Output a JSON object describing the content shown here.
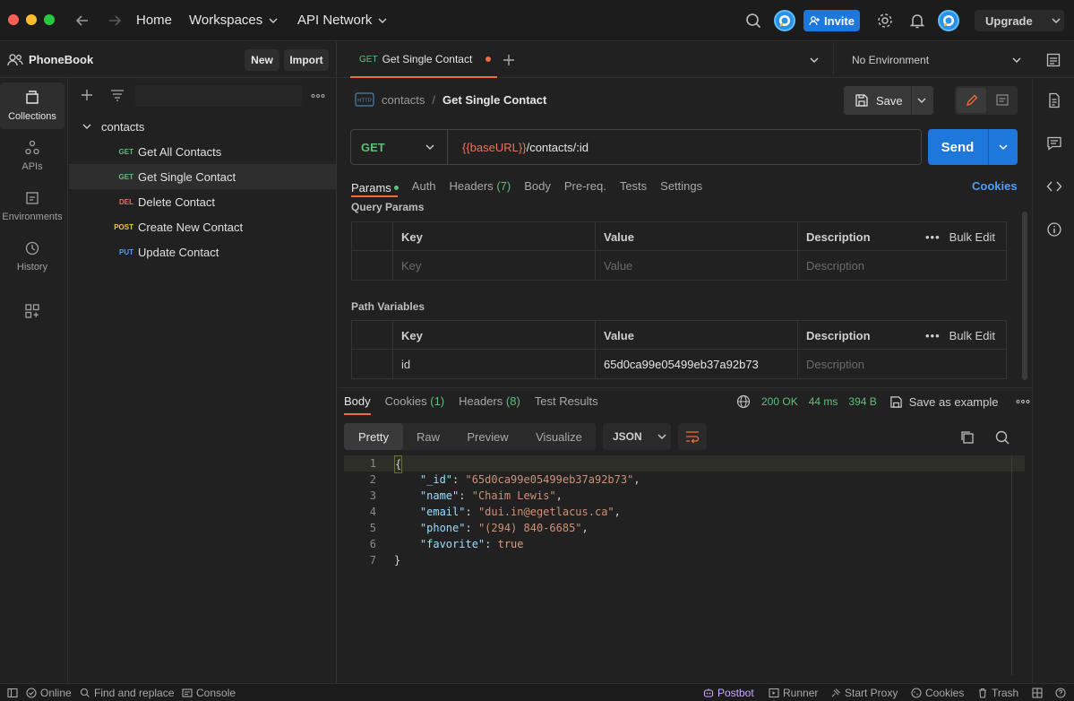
{
  "titlebar": {
    "nav": {
      "home": "Home",
      "workspaces": "Workspaces",
      "api_network": "API Network"
    },
    "invite": "Invite",
    "upgrade": "Upgrade"
  },
  "sidebar": {
    "workspace": "PhoneBook",
    "new": "New",
    "import": "Import",
    "rail": [
      {
        "label": "Collections",
        "icon": "collections-icon"
      },
      {
        "label": "APIs",
        "icon": "apis-icon"
      },
      {
        "label": "Environments",
        "icon": "environments-icon"
      },
      {
        "label": "History",
        "icon": "history-icon"
      }
    ],
    "collection": "contacts",
    "requests": [
      {
        "method": "GET",
        "name": "Get All Contacts"
      },
      {
        "method": "GET",
        "name": "Get Single Contact"
      },
      {
        "method": "DEL",
        "name": "Delete Contact"
      },
      {
        "method": "POST",
        "name": "Create New Contact"
      },
      {
        "method": "PUT",
        "name": "Update Contact"
      }
    ]
  },
  "tabs": {
    "active_method": "GET",
    "active_name": "Get Single Contact",
    "environment": "No Environment"
  },
  "request": {
    "breadcrumb_parent": "contacts",
    "breadcrumb_sep": "/",
    "breadcrumb_current": "Get Single Contact",
    "save": "Save",
    "method": "GET",
    "url_var": "{{baseURL}}",
    "url_path": "/contacts/:id",
    "send": "Send",
    "tabs": {
      "params": "Params",
      "auth": "Auth",
      "headers": "Headers",
      "headers_count": "(7)",
      "body": "Body",
      "prereq": "Pre-req.",
      "tests": "Tests",
      "settings": "Settings"
    },
    "cookies": "Cookies",
    "query_params": {
      "title": "Query Params",
      "headers": {
        "key": "Key",
        "value": "Value",
        "description": "Description",
        "bulk_edit": "Bulk Edit"
      },
      "placeholder": {
        "key": "Key",
        "value": "Value",
        "description": "Description"
      }
    },
    "path_variables": {
      "title": "Path Variables",
      "headers": {
        "key": "Key",
        "value": "Value",
        "description": "Description",
        "bulk_edit": "Bulk Edit"
      },
      "row": {
        "key": "id",
        "value": "65d0ca99e05499eb37a92b73",
        "description": "Description"
      }
    }
  },
  "response": {
    "tabs": {
      "body": "Body",
      "cookies": "Cookies",
      "cookies_count": "(1)",
      "headers": "Headers",
      "headers_count": "(8)",
      "test_results": "Test Results"
    },
    "status": "200 OK",
    "time": "44 ms",
    "size": "394 B",
    "save_example": "Save as example",
    "views": {
      "pretty": "Pretty",
      "raw": "Raw",
      "preview": "Preview",
      "visualize": "Visualize"
    },
    "format": "JSON",
    "lines": [
      {
        "n": "1",
        "text": "{"
      },
      {
        "n": "2",
        "key": "\"_id\"",
        "val": "\"65d0ca99e05499eb37a92b73\"",
        "trail": ","
      },
      {
        "n": "3",
        "key": "\"name\"",
        "val": "\"Chaim Lewis\"",
        "trail": ","
      },
      {
        "n": "4",
        "key": "\"email\"",
        "val": "\"dui.in@egetlacus.ca\"",
        "trail": ","
      },
      {
        "n": "5",
        "key": "\"phone\"",
        "val": "\"(294) 840-6685\"",
        "trail": ","
      },
      {
        "n": "6",
        "key": "\"favorite\"",
        "val": "true",
        "trail": ""
      },
      {
        "n": "7",
        "text": "}"
      }
    ]
  },
  "statusbar": {
    "online": "Online",
    "find_replace": "Find and replace",
    "console": "Console",
    "postbot": "Postbot",
    "runner": "Runner",
    "start_proxy": "Start Proxy",
    "cookies": "Cookies",
    "trash": "Trash"
  },
  "colors": {
    "accent": "#1e77db",
    "tab_underline": "#f26b3a",
    "get": "#5fbf7a",
    "delete": "#e8745a",
    "post": "#f0c64a",
    "put": "#4f9ff5"
  }
}
